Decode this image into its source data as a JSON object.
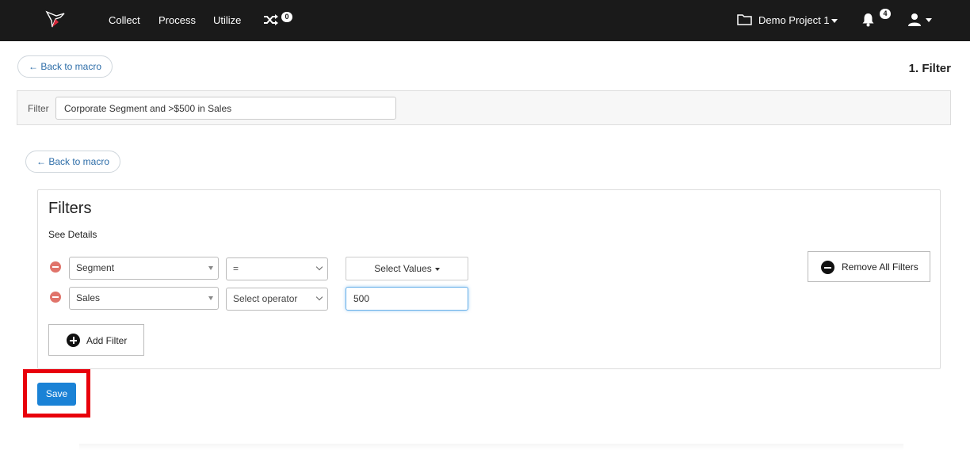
{
  "topbar": {
    "logo": "hummingbird-logo",
    "nav": [
      "Collect",
      "Process",
      "Utilize"
    ],
    "shuffle_badge": "0",
    "project": "Demo Project 1",
    "notifications_badge": "4"
  },
  "header": {
    "back_label": "← Back to macro",
    "step_title": "1. Filter"
  },
  "filter_bar": {
    "label": "Filter",
    "value": "Corporate Segment and >$500 in Sales"
  },
  "panel": {
    "back_label": "← Back to macro",
    "title": "Filters",
    "see_details": "See Details",
    "rows": [
      {
        "field": "Segment",
        "operator": "=",
        "value_button": "Select Values"
      },
      {
        "field": "Sales",
        "operator": "Select operator",
        "value": "500"
      }
    ],
    "add_filter": "Add Filter",
    "remove_all": "Remove All Filters"
  },
  "save_label": "Save",
  "colors": {
    "topbar": "#1a1a1a",
    "link": "#2d6da8",
    "remove_row": "#e0736a",
    "save": "#1a82d6",
    "highlight": "#e8000b"
  }
}
